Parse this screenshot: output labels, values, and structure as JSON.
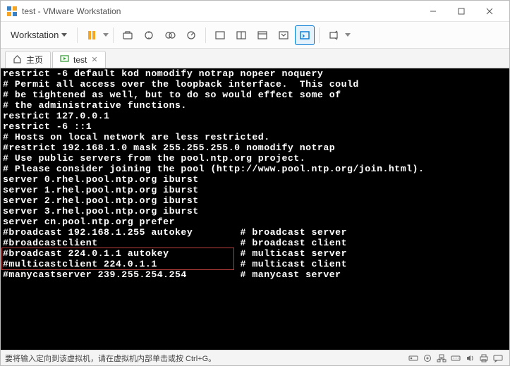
{
  "window": {
    "title": "test - VMware Workstation"
  },
  "menu": {
    "workstation": "Workstation"
  },
  "tabs": {
    "home": "主页",
    "test": "test"
  },
  "terminal": {
    "lines": [
      "restrict -6 default kod nomodify notrap nopeer noquery",
      "",
      "# Permit all access over the loopback interface.  This could",
      "# be tightened as well, but to do so would effect some of",
      "# the administrative functions.",
      "restrict 127.0.0.1",
      "restrict -6 ::1",
      "",
      "# Hosts on local network are less restricted.",
      "#restrict 192.168.1.0 mask 255.255.255.0 nomodify notrap",
      "",
      "# Use public servers from the pool.ntp.org project.",
      "# Please consider joining the pool (http://www.pool.ntp.org/join.html).",
      "server 0.rhel.pool.ntp.org iburst",
      "server 1.rhel.pool.ntp.org iburst",
      "server 2.rhel.pool.ntp.org iburst",
      "server 3.rhel.pool.ntp.org iburst",
      "server cn.pool.ntp.org prefer",
      "",
      "#broadcast 192.168.1.255 autokey        # broadcast server",
      "#broadcastclient                        # broadcast client",
      "#broadcast 224.0.1.1 autokey            # multicast server",
      "#multicastclient 224.0.1.1              # multicast client",
      "#manycastserver 239.255.254.254         # manycast server"
    ],
    "highlight_line_index": 17
  },
  "status": {
    "message": "要将输入定向到该虚拟机，请在虚拟机内部单击或按 Ctrl+G。"
  }
}
